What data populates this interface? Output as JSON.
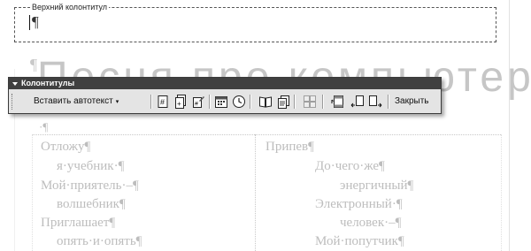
{
  "header": {
    "label": "Верхний колонтитул",
    "cursor_glyph": "¶"
  },
  "document": {
    "margin_pilcrow": "¶",
    "title": "Песня про компьютер",
    "body_pilcrow": "·¶",
    "verse_left": [
      "Отложу¶",
      "я·учебник·¶",
      "Мой·приятель·–¶",
      "волшебник¶",
      "Приглашает¶",
      "опять·и·опять¶"
    ],
    "verse_right": [
      "Припев¶",
      "До·чего·же¶",
      "энергичный¶",
      "Электронный·¶",
      "человек·–¶",
      "Мой·попутчик¶"
    ]
  },
  "toolbar": {
    "title": "Колонтитулы",
    "autotext_label": "Вставить автотекст",
    "autotext_arrow": "▾",
    "close_label": "Закрыть",
    "icons": [
      "insert-page-number-icon",
      "insert-page-count-icon",
      "format-page-number-icon",
      "insert-date-icon",
      "insert-time-icon",
      "page-setup-icon",
      "show-document-text-icon",
      "same-as-previous-icon",
      "switch-header-footer-icon",
      "show-previous-icon",
      "show-next-icon"
    ]
  },
  "colors": {
    "toolbar_title_bg": "#404040",
    "toolbar_bg": "#e4e4e4",
    "ghost_text": "#bdbdbd"
  }
}
